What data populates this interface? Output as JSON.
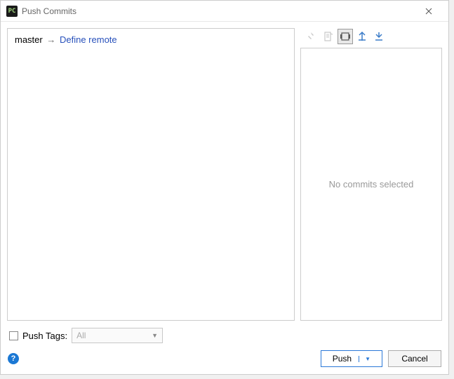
{
  "window": {
    "title": "Push Commits",
    "appIconText": "PC"
  },
  "leftPanel": {
    "branch": "master",
    "defineRemote": "Define remote"
  },
  "rightPanel": {
    "emptyText": "No commits selected"
  },
  "tags": {
    "checkboxLabel": "Push Tags:",
    "selectedOption": "All"
  },
  "buttons": {
    "push": "Push",
    "cancel": "Cancel"
  }
}
